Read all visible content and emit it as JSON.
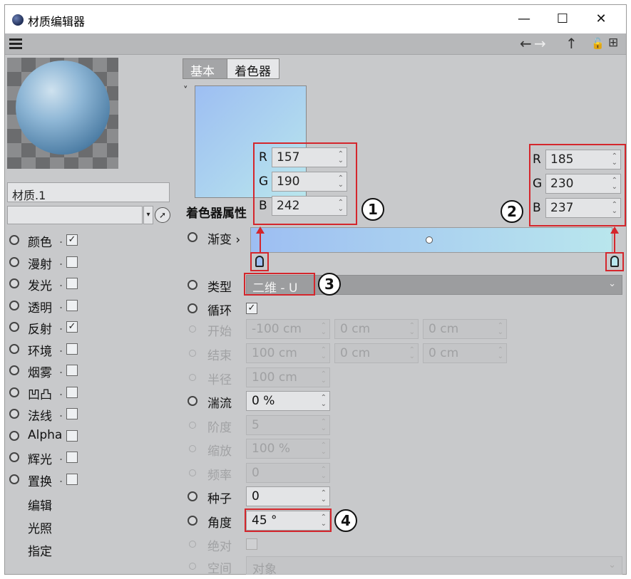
{
  "window": {
    "title": "材质编辑器",
    "controls": {
      "minimize": "—",
      "maximize": "☐",
      "close": "✕"
    }
  },
  "toolbar": {
    "menu_icon": "hamburger-icon",
    "back": "←",
    "forward": "→",
    "up": "↑",
    "lock": "🔓",
    "new": "⊞"
  },
  "left": {
    "material_name": "材质.1",
    "material_select": "",
    "channels": [
      {
        "label": "颜色",
        "dot": ".",
        "checked": true,
        "check": "✓"
      },
      {
        "label": "漫射",
        "dot": ".",
        "checked": false,
        "check": ""
      },
      {
        "label": "发光",
        "dot": ".",
        "checked": false,
        "check": ""
      },
      {
        "label": "透明",
        "dot": ".",
        "checked": false,
        "check": ""
      },
      {
        "label": "反射",
        "dot": ".",
        "checked": true,
        "check": "✓"
      },
      {
        "label": "环境",
        "dot": ".",
        "checked": false,
        "check": ""
      },
      {
        "label": "烟雾",
        "dot": ".",
        "checked": false,
        "check": ""
      },
      {
        "label": "凹凸",
        "dot": ".",
        "checked": false,
        "check": ""
      },
      {
        "label": "法线",
        "dot": ".",
        "checked": false,
        "check": ""
      },
      {
        "label": "Alpha",
        "dot": "",
        "checked": false,
        "check": ""
      },
      {
        "label": "辉光",
        "dot": ".",
        "checked": false,
        "check": ""
      },
      {
        "label": "置换",
        "dot": ".",
        "checked": false,
        "check": ""
      }
    ],
    "links": [
      "编辑",
      "光照",
      "指定"
    ]
  },
  "tabs": [
    "基本",
    "着色器"
  ],
  "section_title": "着色器属性",
  "gradient": {
    "label": "渐变",
    "label_arrow": "›",
    "start_color": "#9dbef2",
    "end_color": "#b9e6ed",
    "left_knot": {
      "R": "157",
      "G": "190",
      "B": "242"
    },
    "right_knot": {
      "R": "185",
      "G": "230",
      "B": "237"
    },
    "rgb_keys": [
      "R",
      "G",
      "B"
    ]
  },
  "params": {
    "type": {
      "label": "类型",
      "value": "二维 - U"
    },
    "cycle": {
      "label": "循环",
      "check": "✓"
    },
    "start": {
      "label": "开始",
      "values": [
        "-100 cm",
        "0 cm",
        "0 cm"
      ]
    },
    "end": {
      "label": "结束",
      "values": [
        "100 cm",
        "0 cm",
        "0 cm"
      ]
    },
    "radius": {
      "label": "半径",
      "value": "100 cm"
    },
    "turbulence": {
      "label": "湍流",
      "value": "0 %"
    },
    "octaves": {
      "label": "阶度",
      "value": "5"
    },
    "scale": {
      "label": "缩放",
      "value": "100 %"
    },
    "frequency": {
      "label": "频率",
      "value": "0"
    },
    "seed": {
      "label": "种子",
      "value": "0"
    },
    "angle": {
      "label": "角度",
      "value": "45 °"
    },
    "absolute": {
      "label": "绝对",
      "check": ""
    },
    "space": {
      "label": "空间",
      "value": "对象"
    }
  },
  "callouts": [
    "1",
    "2",
    "3",
    "4"
  ],
  "colors": {
    "highlight": "#d4262c",
    "panel": "#c8c9cb"
  }
}
